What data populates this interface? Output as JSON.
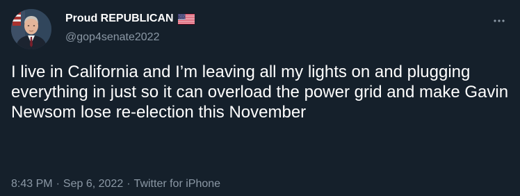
{
  "author": {
    "display_name": "Proud REPUBLICAN",
    "handle": "@gop4senate2022",
    "avatar_icon": "user-avatar",
    "name_badge_icon": "us-flag-icon"
  },
  "tweet": {
    "text": "I live in California and I’m leaving all my lights on and plugging everything in just so it can overload the power grid and make Gavin Newsom lose re-election this November",
    "time": "8:43 PM",
    "separator": "·",
    "date": "Sep 6, 2022",
    "source": "Twitter for iPhone"
  },
  "menu": {
    "icon": "more-horizontal-icon"
  },
  "colors": {
    "background": "#15202b",
    "primary_text": "#ffffff",
    "secondary_text": "#8b98a5"
  }
}
